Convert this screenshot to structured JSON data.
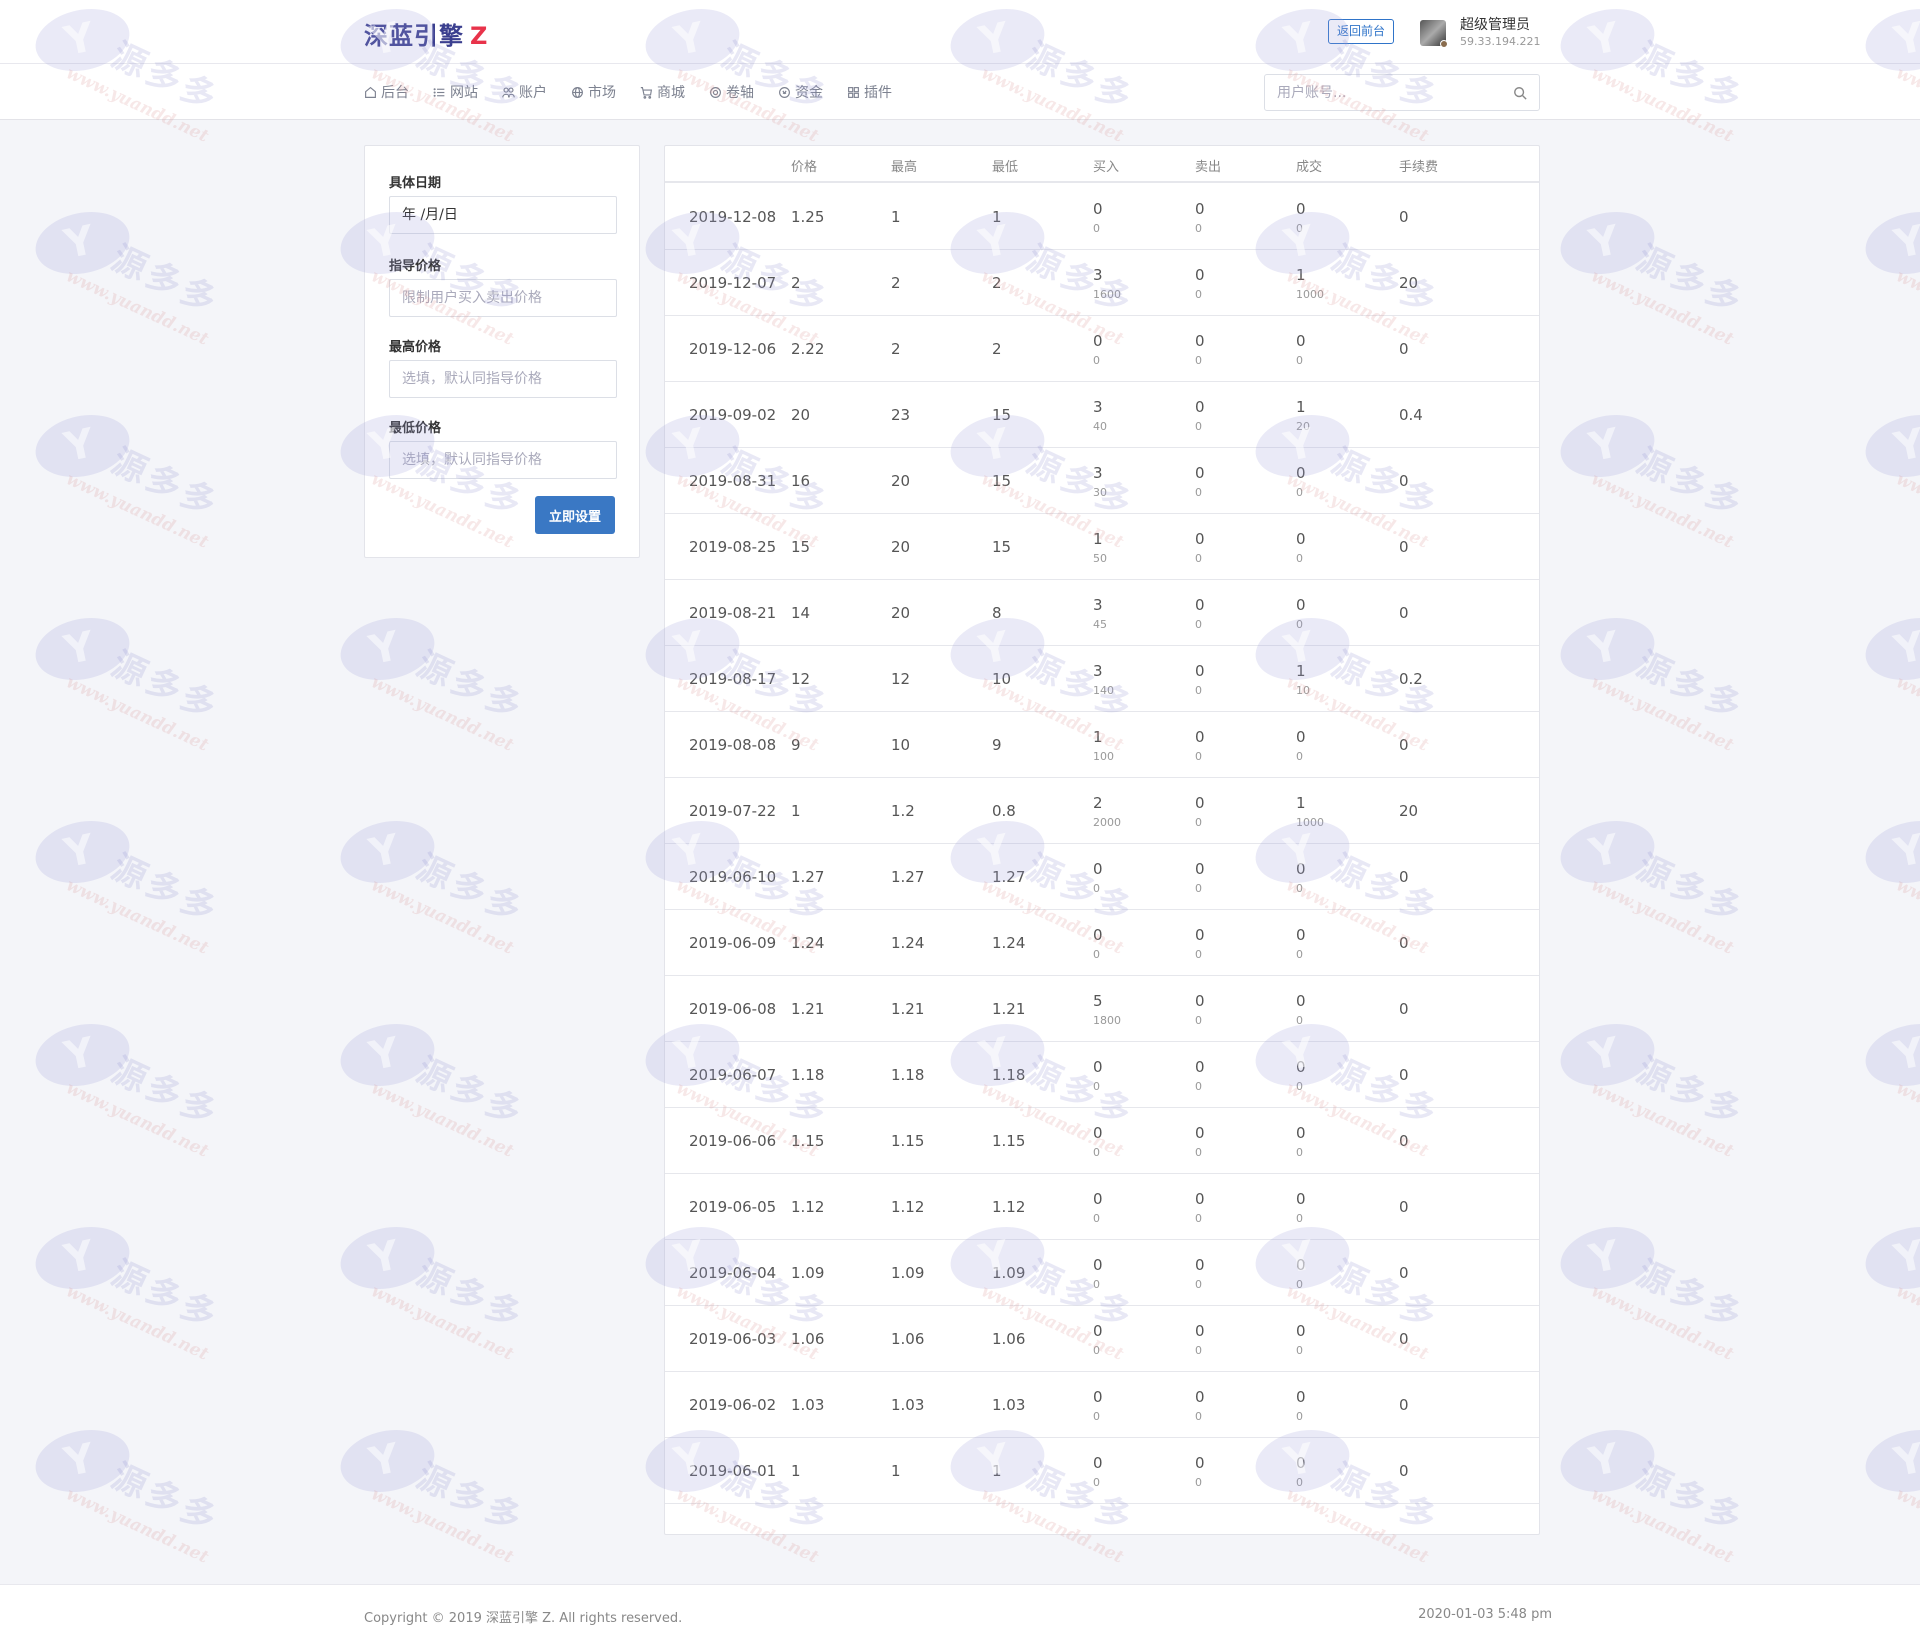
{
  "header": {
    "logo_text": "深蓝引擎",
    "logo_mark": "Z",
    "back_button": "返回前台",
    "user_name": "超级管理员",
    "user_ip": "59.33.194.221"
  },
  "nav": [
    {
      "label": "后台",
      "icon": "home-icon"
    },
    {
      "label": "网站",
      "icon": "list-icon"
    },
    {
      "label": "账户",
      "icon": "users-icon"
    },
    {
      "label": "市场",
      "icon": "globe-icon"
    },
    {
      "label": "商城",
      "icon": "cart-icon"
    },
    {
      "label": "卷轴",
      "icon": "gear-icon"
    },
    {
      "label": "资金",
      "icon": "coin-icon"
    },
    {
      "label": "插件",
      "icon": "grid-icon"
    }
  ],
  "search": {
    "placeholder": "用户账号..."
  },
  "form": {
    "date_label": "具体日期",
    "date_value": "年 /月/日",
    "guide_label": "指导价格",
    "guide_placeholder": "限制用户买入卖出价格",
    "max_label": "最高价格",
    "max_placeholder": "选填，默认同指导价格",
    "min_label": "最低价格",
    "min_placeholder": "选填，默认同指导价格",
    "submit": "立即设置"
  },
  "table": {
    "columns": [
      "价格",
      "最高",
      "最低",
      "买入",
      "卖出",
      "成交",
      "手续费"
    ],
    "rows": [
      {
        "date": "2019-12-08",
        "price": "1.25",
        "high": "1",
        "low": "1",
        "buy": "0",
        "buy_sub": "0",
        "sell": "0",
        "sell_sub": "0",
        "deal": "0",
        "deal_sub": "0",
        "fee": "0"
      },
      {
        "date": "2019-12-07",
        "price": "2",
        "high": "2",
        "low": "2",
        "buy": "3",
        "buy_sub": "1600",
        "sell": "0",
        "sell_sub": "0",
        "deal": "1",
        "deal_sub": "1000",
        "fee": "20"
      },
      {
        "date": "2019-12-06",
        "price": "2.22",
        "high": "2",
        "low": "2",
        "buy": "0",
        "buy_sub": "0",
        "sell": "0",
        "sell_sub": "0",
        "deal": "0",
        "deal_sub": "0",
        "fee": "0"
      },
      {
        "date": "2019-09-02",
        "price": "20",
        "high": "23",
        "low": "15",
        "buy": "3",
        "buy_sub": "40",
        "sell": "0",
        "sell_sub": "0",
        "deal": "1",
        "deal_sub": "20",
        "fee": "0.4"
      },
      {
        "date": "2019-08-31",
        "price": "16",
        "high": "20",
        "low": "15",
        "buy": "3",
        "buy_sub": "30",
        "sell": "0",
        "sell_sub": "0",
        "deal": "0",
        "deal_sub": "0",
        "fee": "0"
      },
      {
        "date": "2019-08-25",
        "price": "15",
        "high": "20",
        "low": "15",
        "buy": "1",
        "buy_sub": "50",
        "sell": "0",
        "sell_sub": "0",
        "deal": "0",
        "deal_sub": "0",
        "fee": "0"
      },
      {
        "date": "2019-08-21",
        "price": "14",
        "high": "20",
        "low": "8",
        "buy": "3",
        "buy_sub": "45",
        "sell": "0",
        "sell_sub": "0",
        "deal": "0",
        "deal_sub": "0",
        "fee": "0"
      },
      {
        "date": "2019-08-17",
        "price": "12",
        "high": "12",
        "low": "10",
        "buy": "3",
        "buy_sub": "140",
        "sell": "0",
        "sell_sub": "0",
        "deal": "1",
        "deal_sub": "10",
        "fee": "0.2"
      },
      {
        "date": "2019-08-08",
        "price": "9",
        "high": "10",
        "low": "9",
        "buy": "1",
        "buy_sub": "100",
        "sell": "0",
        "sell_sub": "0",
        "deal": "0",
        "deal_sub": "0",
        "fee": "0"
      },
      {
        "date": "2019-07-22",
        "price": "1",
        "high": "1.2",
        "low": "0.8",
        "buy": "2",
        "buy_sub": "2000",
        "sell": "0",
        "sell_sub": "0",
        "deal": "1",
        "deal_sub": "1000",
        "fee": "20"
      },
      {
        "date": "2019-06-10",
        "price": "1.27",
        "high": "1.27",
        "low": "1.27",
        "buy": "0",
        "buy_sub": "0",
        "sell": "0",
        "sell_sub": "0",
        "deal": "0",
        "deal_sub": "0",
        "fee": "0"
      },
      {
        "date": "2019-06-09",
        "price": "1.24",
        "high": "1.24",
        "low": "1.24",
        "buy": "0",
        "buy_sub": "0",
        "sell": "0",
        "sell_sub": "0",
        "deal": "0",
        "deal_sub": "0",
        "fee": "0"
      },
      {
        "date": "2019-06-08",
        "price": "1.21",
        "high": "1.21",
        "low": "1.21",
        "buy": "5",
        "buy_sub": "1800",
        "sell": "0",
        "sell_sub": "0",
        "deal": "0",
        "deal_sub": "0",
        "fee": "0"
      },
      {
        "date": "2019-06-07",
        "price": "1.18",
        "high": "1.18",
        "low": "1.18",
        "buy": "0",
        "buy_sub": "0",
        "sell": "0",
        "sell_sub": "0",
        "deal": "0",
        "deal_sub": "0",
        "fee": "0"
      },
      {
        "date": "2019-06-06",
        "price": "1.15",
        "high": "1.15",
        "low": "1.15",
        "buy": "0",
        "buy_sub": "0",
        "sell": "0",
        "sell_sub": "0",
        "deal": "0",
        "deal_sub": "0",
        "fee": "0"
      },
      {
        "date": "2019-06-05",
        "price": "1.12",
        "high": "1.12",
        "low": "1.12",
        "buy": "0",
        "buy_sub": "0",
        "sell": "0",
        "sell_sub": "0",
        "deal": "0",
        "deal_sub": "0",
        "fee": "0"
      },
      {
        "date": "2019-06-04",
        "price": "1.09",
        "high": "1.09",
        "low": "1.09",
        "buy": "0",
        "buy_sub": "0",
        "sell": "0",
        "sell_sub": "0",
        "deal": "0",
        "deal_sub": "0",
        "fee": "0"
      },
      {
        "date": "2019-06-03",
        "price": "1.06",
        "high": "1.06",
        "low": "1.06",
        "buy": "0",
        "buy_sub": "0",
        "sell": "0",
        "sell_sub": "0",
        "deal": "0",
        "deal_sub": "0",
        "fee": "0"
      },
      {
        "date": "2019-06-02",
        "price": "1.03",
        "high": "1.03",
        "low": "1.03",
        "buy": "0",
        "buy_sub": "0",
        "sell": "0",
        "sell_sub": "0",
        "deal": "0",
        "deal_sub": "0",
        "fee": "0"
      },
      {
        "date": "2019-06-01",
        "price": "1",
        "high": "1",
        "low": "1",
        "buy": "0",
        "buy_sub": "0",
        "sell": "0",
        "sell_sub": "0",
        "deal": "0",
        "deal_sub": "0",
        "fee": "0"
      }
    ]
  },
  "footer": {
    "copyright": "Copyright © 2019 深蓝引擎 Z. All rights reserved.",
    "time": "2020-01-03 5:48 pm"
  },
  "watermark": {
    "text": "源多多",
    "url": "www.yuandd.net"
  },
  "colors": {
    "accent": "#3a78c4",
    "logo": "#3b3f8f",
    "logo_mark": "#e8334a"
  }
}
